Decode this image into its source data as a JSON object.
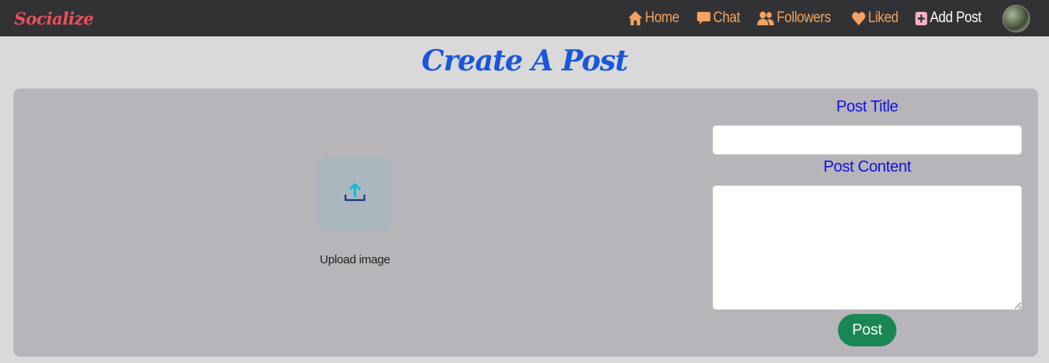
{
  "navbar": {
    "brand": "Socialize",
    "links": [
      {
        "label": "Home",
        "icon": "home-icon"
      },
      {
        "label": "Chat",
        "icon": "chat-icon"
      },
      {
        "label": "Followers",
        "icon": "users-icon"
      },
      {
        "label": "Liked",
        "icon": "heart-icon"
      },
      {
        "label": "Add Post",
        "icon": "plus-square-icon"
      }
    ],
    "avatar_icon": "avatar"
  },
  "page": {
    "title": "Create A Post"
  },
  "upload": {
    "label": "Upload image",
    "icon": "upload-icon"
  },
  "form": {
    "title_label": "Post Title",
    "title_value": "",
    "content_label": "Post Content",
    "content_value": "",
    "submit_label": "Post"
  },
  "colors": {
    "brand": "#e8505b",
    "nav_link": "#f4a261",
    "title": "#1a56db",
    "form_label": "#1212e0",
    "button": "#198754",
    "panel": "#b7b5ba",
    "navbar": "#323234"
  }
}
